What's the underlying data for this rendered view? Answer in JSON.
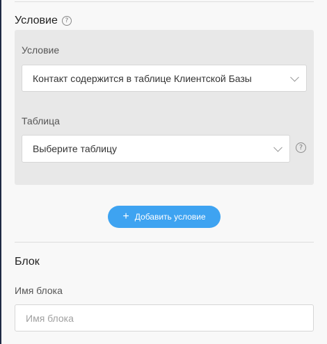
{
  "condition_section": {
    "title": "Условие",
    "help_icon": "question-circle-icon",
    "condition_label": "Условие",
    "condition_value": "Контакт содержится в таблице Клиентской Базы",
    "table_label": "Таблица",
    "table_placeholder": "Выберите таблицу",
    "add_button_label": "Добавить условие",
    "add_button_icon": "plus-icon"
  },
  "block_section": {
    "title": "Блок",
    "name_label": "Имя блока",
    "name_placeholder": "Имя блока",
    "name_value": ""
  },
  "colors": {
    "accent": "#3ea3f1",
    "panel_bg": "#e8e8e8",
    "page_bg": "#f8f8f8"
  }
}
